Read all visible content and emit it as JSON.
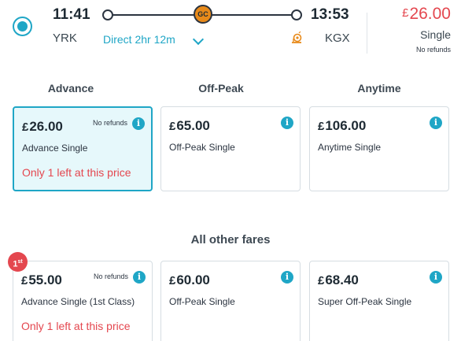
{
  "journey": {
    "departure_time": "11:41",
    "arrival_time": "13:53",
    "origin": "YRK",
    "destination": "KGX",
    "operator_badge": "GC",
    "direct_label": "Direct 2hr 12m",
    "price_currency": "£",
    "price_amount": "26.00",
    "price_type": "Single",
    "refund_note": "No refunds"
  },
  "columns": [
    "Advance",
    "Off-Peak",
    "Anytime"
  ],
  "fares_top": [
    {
      "currency": "£",
      "amount": "26.00",
      "name": "Advance Single",
      "refund": "No refunds",
      "scarcity": "Only 1 left at this price"
    },
    {
      "currency": "£",
      "amount": "65.00",
      "name": "Off-Peak Single"
    },
    {
      "currency": "£",
      "amount": "106.00",
      "name": "Anytime Single"
    }
  ],
  "other_heading": "All other fares",
  "badge": {
    "number": "1",
    "suffix": "st"
  },
  "fares_other": [
    {
      "currency": "£",
      "amount": "55.00",
      "name": "Advance Single (1st Class)",
      "refund": "No refunds",
      "scarcity": "Only 1 left at this price"
    },
    {
      "currency": "£",
      "amount": "60.00",
      "name": "Off-Peak Single"
    },
    {
      "currency": "£",
      "amount": "68.40",
      "name": "Super Off-Peak Single"
    }
  ],
  "info_glyph": "i",
  "colors": {
    "accent": "#1fa6c6",
    "price_red": "#e4474f",
    "operator_orange": "#e88a1a",
    "selected_bg": "#e6f8fb"
  }
}
